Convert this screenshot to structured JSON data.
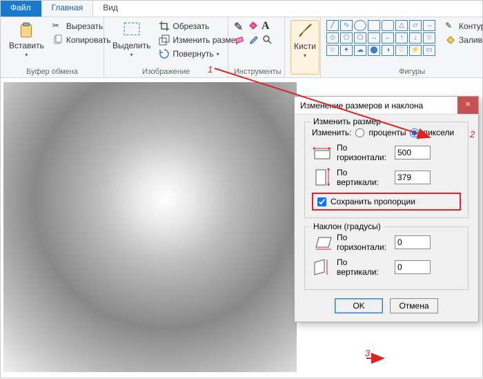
{
  "tabs": {
    "file": "Файл",
    "home": "Главная",
    "view": "Вид"
  },
  "clipboard": {
    "title": "Буфер обмена",
    "paste": "Вставить",
    "cut": "Вырезать",
    "copy": "Копировать"
  },
  "image": {
    "title": "Изображение",
    "select": "Выделить",
    "crop": "Обрезать",
    "resize": "Изменить размер",
    "rotate": "Повернуть"
  },
  "tools": {
    "title": "Инструменты"
  },
  "brushes": {
    "title": "Кисти"
  },
  "shapes": {
    "title": "Фигуры",
    "outline": "Контур",
    "fill": "Заливка"
  },
  "dialog": {
    "title": "Изменение размеров и наклона",
    "resize_legend": "Изменить размер",
    "change": "Изменить:",
    "percent": "проценты",
    "pixels": "пиксели",
    "horiz": "По горизонтали:",
    "vert": "По вертикали:",
    "width": "500",
    "height": "379",
    "keep_ratio": "Сохранить пропорции",
    "skew_legend": "Наклон (градусы)",
    "skew_h": "0",
    "skew_v": "0",
    "ok": "OK",
    "cancel": "Отмена"
  },
  "markers": {
    "m1": "1",
    "m2": "2",
    "m3": "3"
  }
}
